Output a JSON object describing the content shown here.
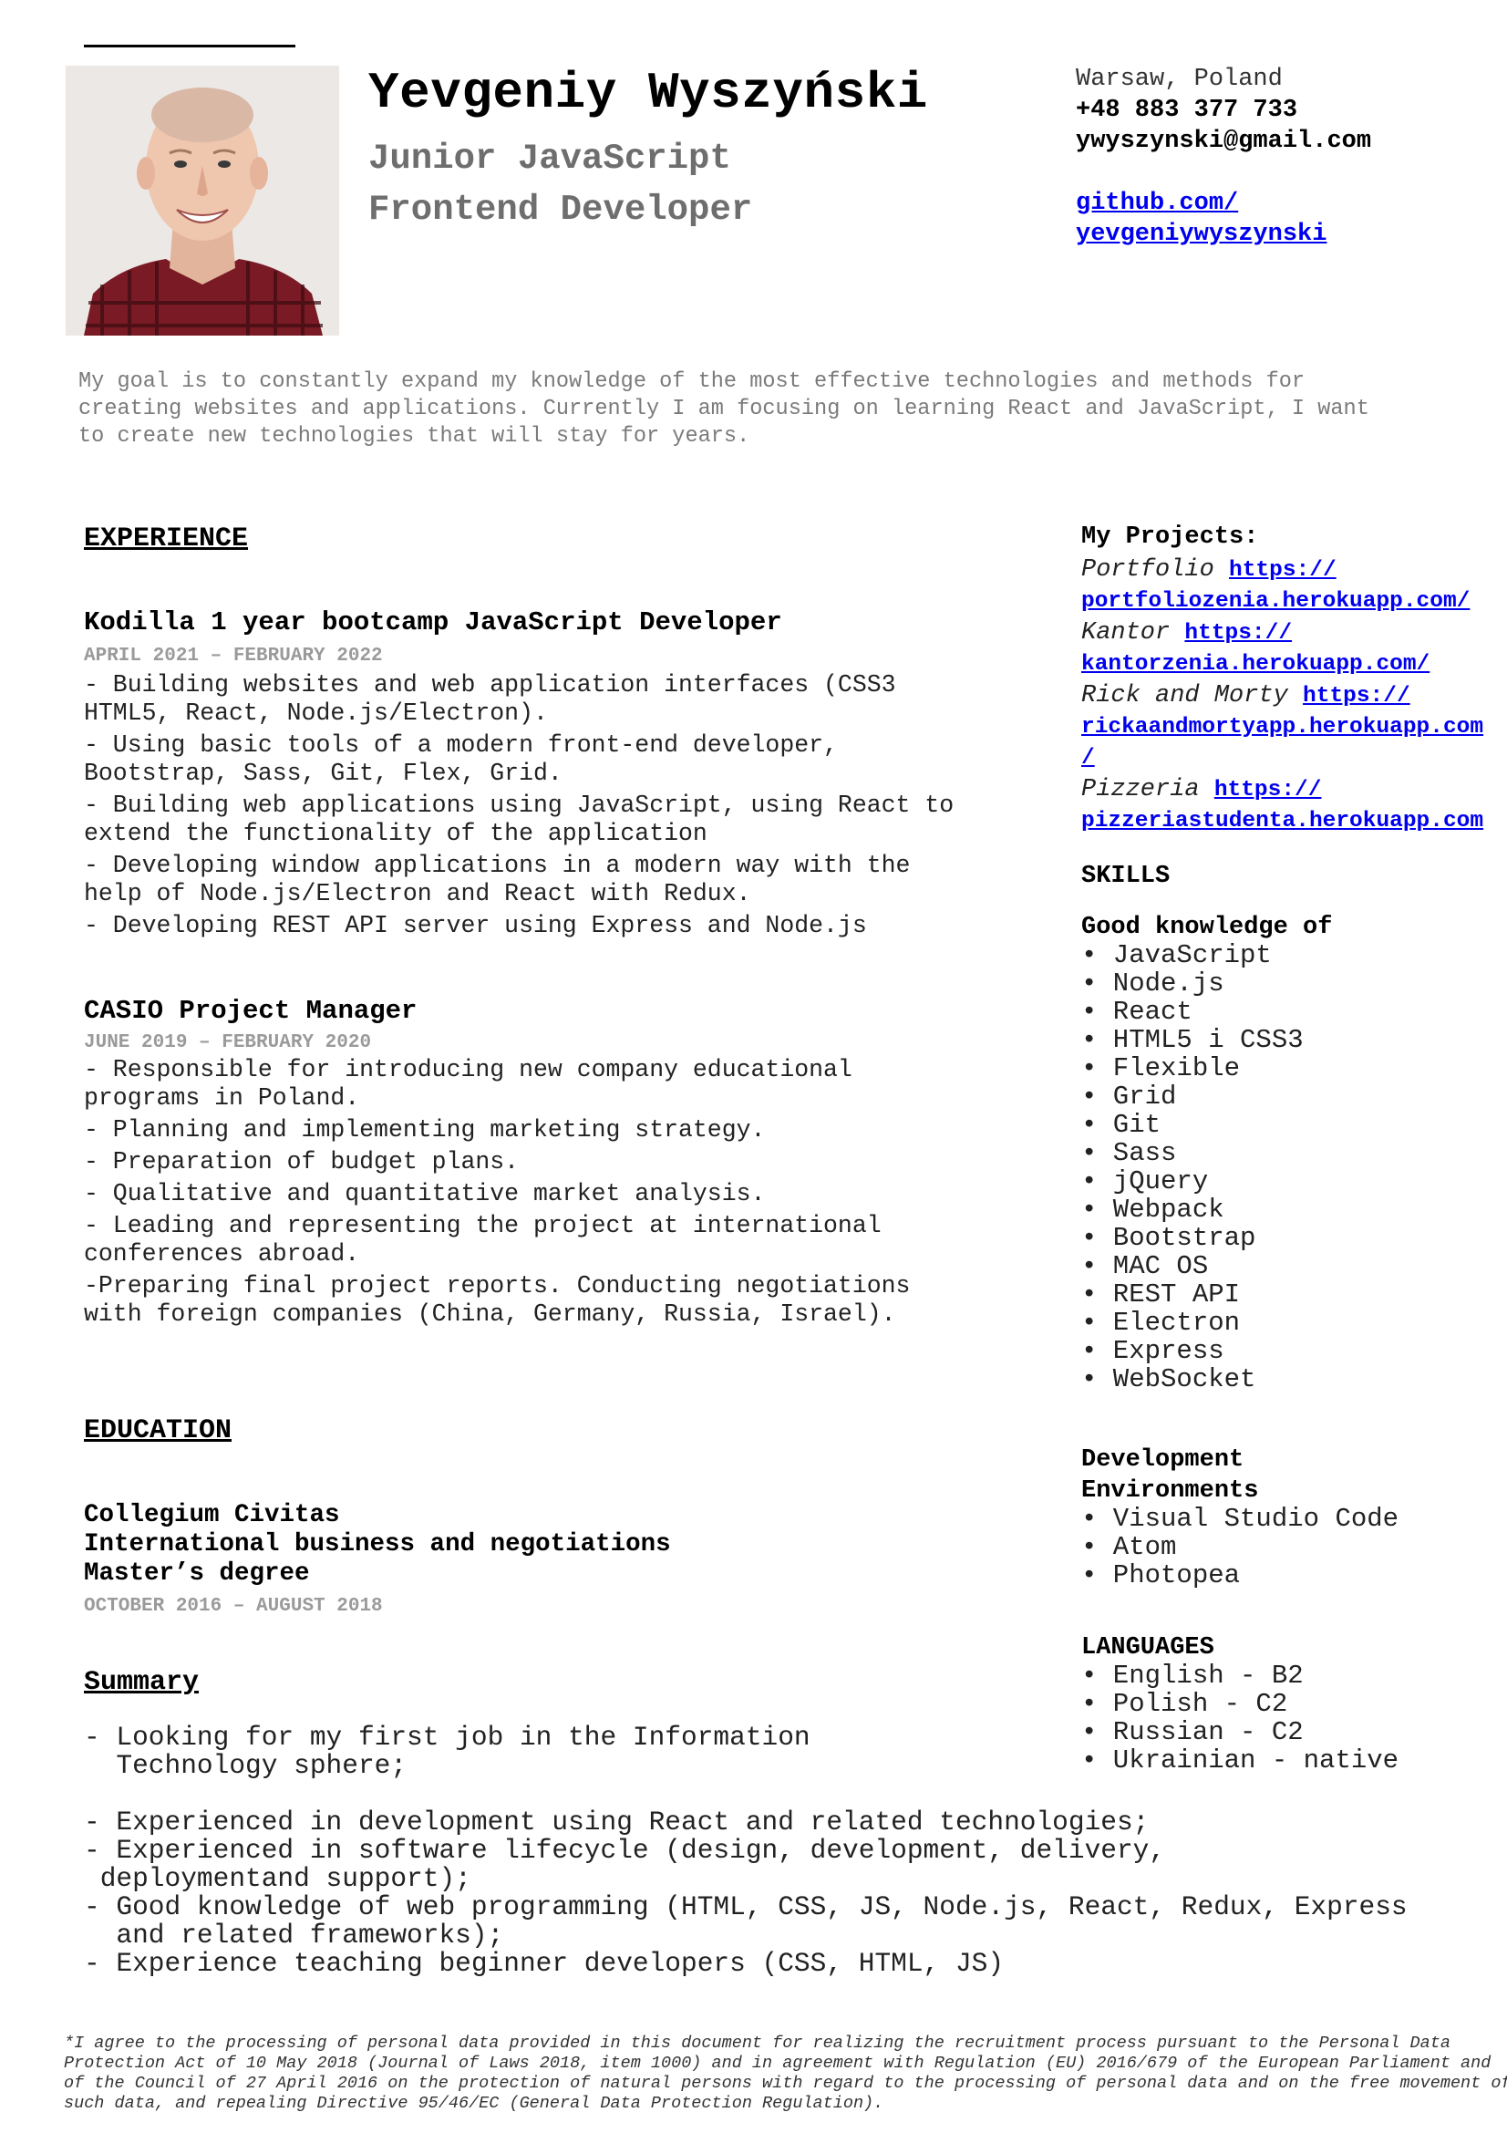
{
  "header": {
    "name": "Yevgeniy Wyszyński",
    "role_line1": "Junior JavaScript",
    "role_line2": "Frontend Developer"
  },
  "contact": {
    "city": "Warsaw, Poland",
    "phone": "+48 883 377 733",
    "email": "ywyszynski@gmail.com",
    "github_line1": "github.com/",
    "github_line2": "yevgeniywyszynski"
  },
  "goal": "My goal is to constantly expand my knowledge of the most effective technologies and methods for creating websites and applications. Currently I am focusing on learning React and JavaScript, I want to create new technologies that will stay for years.",
  "experience": {
    "title": "EXPERIENCE",
    "jobs": [
      {
        "title": "Kodilla 1 year bootcamp JavaScript Developer",
        "dates": "APRIL 2021 – FEBRUARY 2022",
        "items": [
          "- Building websites and web application interfaces (CSS3 HTML5, React, Node.js/Electron).",
          "- Using basic tools of a modern front-end developer, Bootstrap, Sass, Git, Flex, Grid.",
          "- Building web applications using JavaScript, using React to extend the functionality of the application",
          "- Developing window applications in a modern way with the help of Node.js/Electron and React with Redux.",
          "- Developing REST API server using Express and Node.js"
        ]
      },
      {
        "title": "CASIO Project Manager",
        "dates": "JUNE 2019 – FEBRUARY 2020",
        "items": [
          "- Responsible for introducing new company educational programs in Poland.",
          "- Planning and implementing marketing strategy.",
          "- Preparation of budget plans.",
          "- Qualitative and quantitative market analysis.",
          "- Leading and representing the project at international conferences abroad.",
          "-Preparing final project reports. Conducting negotiations with foreign companies (China, Germany, Russia, Israel)."
        ]
      }
    ]
  },
  "education": {
    "title": "EDUCATION",
    "school": "Collegium Civitas",
    "field": "International business and negotiations",
    "degree": "Master’s degree",
    "dates": "OCTOBER 2016 – AUGUST 2018"
  },
  "summary": {
    "title": "Summary",
    "text": "- Looking for my first job in the Information\n  Technology sphere;\n\n- Experienced in development using React and related technologies;\n- Experienced in software lifecycle (design, development, delivery,\n deploymentand support);\n- Good knowledge of web programming (HTML, CSS, JS, Node.js, React, Redux, Express\n  and related frameworks);\n- Experience teaching beginner developers (CSS, HTML, JS)"
  },
  "projects": {
    "title": "My Projects:",
    "items": [
      {
        "name": "Portfolio",
        "link_a": "https://",
        "link_b": "portfoliozenia.herokuapp.com/"
      },
      {
        "name": "Kantor",
        "link_a": "https://",
        "link_b": "kantorzenia.herokuapp.com/"
      },
      {
        "name": "Rick and Morty",
        "link_a": "https://",
        "link_b": "rickaandmortyapp.herokuapp.com",
        "link_c": "/"
      },
      {
        "name": "Pizzeria",
        "link_a": "https://",
        "link_b": "pizzeriastudenta.herokuapp.com"
      }
    ]
  },
  "skills": {
    "title": "SKILLS",
    "subtitle": "Good knowledge of",
    "items": [
      "• JavaScript",
      "• Node.js",
      "• React",
      "• HTML5 i CSS3",
      "• Flexible",
      "• Grid",
      "• Git",
      "• Sass",
      "• jQuery",
      "• Webpack",
      "• Bootstrap",
      "• MAC OS",
      "• REST API",
      "• Electron",
      "• Express",
      "• WebSocket"
    ]
  },
  "environments": {
    "title_line1": "Development",
    "title_line2": "Environments",
    "items": [
      "• Visual Studio Code",
      "• Atom",
      "• Photopea"
    ]
  },
  "languages": {
    "title": "LANGUAGES",
    "items": [
      "• English - B2",
      "• Polish - C2",
      "• Russian - C2",
      "• Ukrainian - native"
    ]
  },
  "footer": "*I agree to the processing of personal data provided in this document for realizing the recruitment process pursuant to the Personal Data Protection Act of 10 May 2018 (Journal of Laws 2018, item 1000) and in agreement with Regulation (EU) 2016/679 of the European Parliament and of the Council of 27 April 2016 on the protection of natural persons with regard to the processing of personal data and on the free movement of such data, and repealing Directive 95/46/EC (General Data Protection Regulation)."
}
